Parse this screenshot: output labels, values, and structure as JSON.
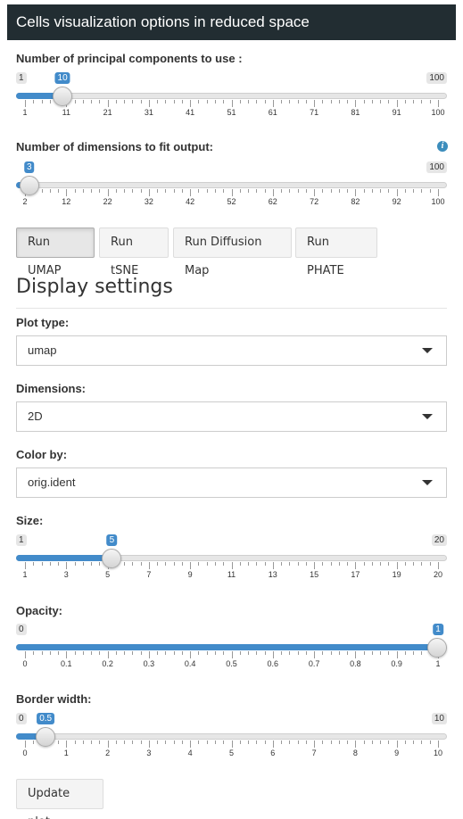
{
  "header": {
    "title": "Cells visualization options in reduced space"
  },
  "pcs": {
    "label": "Number of principal components to use :",
    "min": "1",
    "max": "100",
    "value": "10",
    "fraction": 0.0909,
    "ticks": [
      "1",
      "11",
      "21",
      "31",
      "41",
      "51",
      "61",
      "71",
      "81",
      "91",
      "100"
    ]
  },
  "dims": {
    "label": "Number of dimensions to fit output:",
    "info_icon": "info-icon",
    "min": "",
    "max": "100",
    "value": "3",
    "fraction": 0.0102,
    "ticks": [
      "2",
      "12",
      "22",
      "32",
      "42",
      "52",
      "62",
      "72",
      "82",
      "92",
      "100"
    ]
  },
  "buttons": {
    "run_umap": "Run UMAP",
    "run_tsne": "Run tSNE",
    "run_diffusion": "Run Diffusion Map",
    "run_phate": "Run PHATE"
  },
  "display": {
    "title": "Display settings",
    "plot_type": {
      "label": "Plot type:",
      "value": "umap"
    },
    "dimensions": {
      "label": "Dimensions:",
      "value": "2D"
    },
    "color_by": {
      "label": "Color by:",
      "value": "orig.ident"
    },
    "size": {
      "label": "Size:",
      "min": "1",
      "max": "20",
      "value": "5",
      "fraction": 0.2105,
      "ticks": [
        "1",
        "3",
        "5",
        "7",
        "9",
        "11",
        "13",
        "15",
        "17",
        "19",
        "20"
      ]
    },
    "opacity": {
      "label": "Opacity:",
      "min": "0",
      "max": "",
      "value": "1",
      "fraction": 1.0,
      "ticks": [
        "0",
        "0.1",
        "0.2",
        "0.3",
        "0.4",
        "0.5",
        "0.6",
        "0.7",
        "0.8",
        "0.9",
        "1"
      ]
    },
    "border": {
      "label": "Border width:",
      "min": "0",
      "max": "10",
      "value": "0.5",
      "fraction": 0.05,
      "ticks": [
        "0",
        "1",
        "2",
        "3",
        "4",
        "5",
        "6",
        "7",
        "8",
        "9",
        "10"
      ]
    },
    "update_button": "Update plot"
  },
  "colors": {
    "header_bg": "#222d32",
    "accent": "#428bca"
  }
}
